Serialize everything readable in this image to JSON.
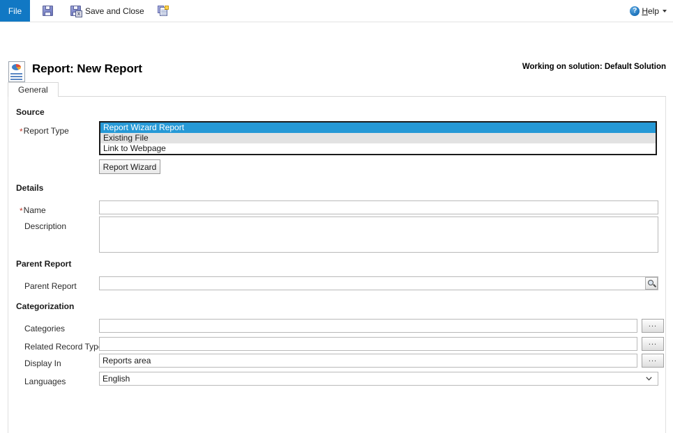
{
  "ribbon": {
    "file_tab": "File",
    "save_label": "",
    "save_and_close_label": "Save and Close",
    "save_and_new_label": "",
    "help_label_prefix": "H",
    "help_label_rest": "elp",
    "icons": {
      "save": "save-floppy-icon",
      "save_and_close": "save-and-close-icon",
      "save_and_new": "save-and-new-icon",
      "help": "help-circle-icon",
      "help_caret": "chevron-down-icon"
    }
  },
  "header": {
    "title": "Report: New Report",
    "solution_note": "Working on solution: Default Solution",
    "icon": "report-document-icon"
  },
  "tabs": [
    {
      "label": "General",
      "active": true
    }
  ],
  "form": {
    "sections": {
      "source": {
        "title": "Source",
        "report_type": {
          "label": "Report Type",
          "required": true,
          "options": [
            "Report Wizard Report",
            "Existing File",
            "Link to Webpage"
          ],
          "selected_index": 0
        },
        "report_wizard_button": "Report Wizard"
      },
      "details": {
        "title": "Details",
        "name": {
          "label": "Name",
          "required": true,
          "value": "",
          "placeholder": ""
        },
        "description": {
          "label": "Description",
          "required": false,
          "value": "",
          "placeholder": ""
        }
      },
      "parent_report": {
        "title": "Parent Report",
        "parent_report": {
          "label": "Parent Report",
          "value": "",
          "placeholder": "",
          "lookup_icon": "magnifier-lookup-icon"
        }
      },
      "categorization": {
        "title": "Categorization",
        "categories": {
          "label": "Categories",
          "value": "",
          "placeholder": "",
          "browse_label": "..."
        },
        "related_record_types": {
          "label": "Related Record Types",
          "value": "",
          "placeholder": "",
          "browse_label": "..."
        },
        "display_in": {
          "label": "Display In",
          "value": "Reports area",
          "placeholder": "",
          "browse_label": "..."
        },
        "languages": {
          "label": "Languages",
          "value": "English",
          "options": [
            "English"
          ]
        }
      }
    }
  },
  "colors": {
    "accent_blue": "#1178c4",
    "selection_blue": "#2699d6",
    "required_red": "#c0392b",
    "field_border": "#b9b9b9"
  }
}
